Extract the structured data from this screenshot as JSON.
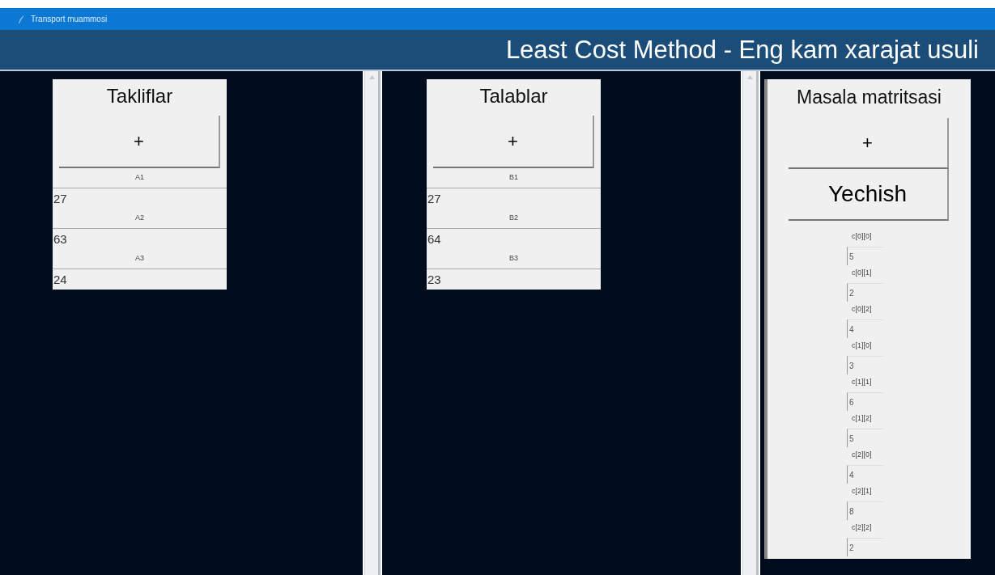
{
  "window": {
    "title": "Transport muammosi"
  },
  "header": {
    "title": "Least Cost Method - Eng kam xarajat usuli"
  },
  "panels": [
    {
      "title": "Takliflar",
      "add_button": "+",
      "items": [
        {
          "label": "A1",
          "value": "27"
        },
        {
          "label": "A2",
          "value": "63"
        },
        {
          "label": "A3",
          "value": "24"
        }
      ]
    },
    {
      "title": "Talablar",
      "add_button": "+",
      "items": [
        {
          "label": "B1",
          "value": "27"
        },
        {
          "label": "B2",
          "value": "64"
        },
        {
          "label": "B3",
          "value": "23"
        }
      ]
    }
  ],
  "matrix": {
    "title": "Masala matritsasi",
    "add_button": "+",
    "solve_button": "Yechish",
    "cells": [
      {
        "label": "c[0][0]",
        "value": "5"
      },
      {
        "label": "c[0][1]",
        "value": "2"
      },
      {
        "label": "c[0][2]",
        "value": "4"
      },
      {
        "label": "c[1][0]",
        "value": "3"
      },
      {
        "label": "c[1][1]",
        "value": "6"
      },
      {
        "label": "c[1][2]",
        "value": "5"
      },
      {
        "label": "c[2][0]",
        "value": "4"
      },
      {
        "label": "c[2][1]",
        "value": "8"
      },
      {
        "label": "c[2][2]",
        "value": "2"
      }
    ]
  }
}
